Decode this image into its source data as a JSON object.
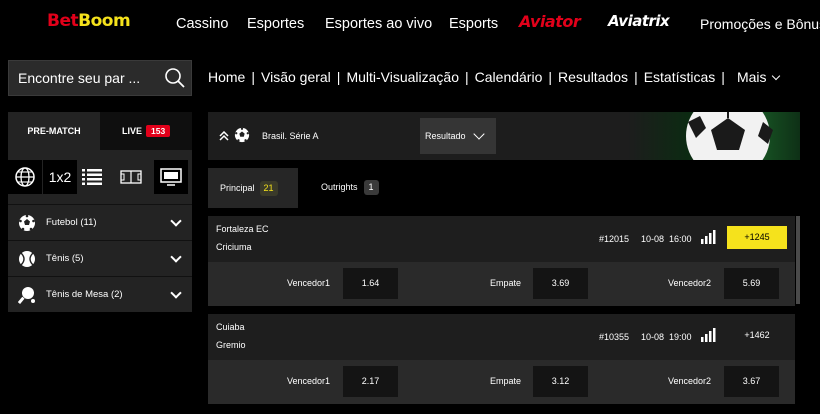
{
  "brand": {
    "part1": "Bet",
    "part2": "Boom"
  },
  "topnav": {
    "items": [
      "Cassino",
      "Esportes",
      "Esportes ao vivo",
      "Esports"
    ],
    "aviator": "Aviator",
    "aviatrix": "Aviatrix",
    "promo": "Promoções e Bônus"
  },
  "search": {
    "placeholder": "Encontre seu par ..."
  },
  "subnav": {
    "items": [
      "Home",
      "Visão geral",
      "Multi-Visualização",
      "Calendário",
      "Resultados",
      "Estatísticas"
    ],
    "more": "Mais"
  },
  "leftpanel": {
    "tab_prematch": "PRE-MATCH",
    "tab_live": "LIVE",
    "live_count": "153",
    "icon_1x2": "1x2",
    "sports": [
      {
        "label": "Futebol (11)",
        "icon": "soccer-ball-icon"
      },
      {
        "label": "Tênis (5)",
        "icon": "tennis-ball-icon"
      },
      {
        "label": "Tênis de Mesa (2)",
        "icon": "ping-pong-icon"
      }
    ]
  },
  "event_header": {
    "league": "Brasil. Série A",
    "dropdown": "Resultado"
  },
  "tabs": {
    "principal": "Principal",
    "principal_count": "21",
    "outrights": "Outrights",
    "outrights_count": "1"
  },
  "matches": [
    {
      "team1": "Fortaleza EC",
      "team2": "Criciuma",
      "id": "#12015",
      "date": "10-08",
      "time": "16:00",
      "more": "+1245",
      "highlight": true,
      "odds": [
        {
          "label": "Vencedor1",
          "value": "1.64"
        },
        {
          "label": "Empate",
          "value": "3.69"
        },
        {
          "label": "Vencedor2",
          "value": "5.69"
        }
      ]
    },
    {
      "team1": "Cuiaba",
      "team2": "Gremio",
      "id": "#10355",
      "date": "10-08",
      "time": "19:00",
      "more": "+1462",
      "highlight": false,
      "odds": [
        {
          "label": "Vencedor1",
          "value": "2.17"
        },
        {
          "label": "Empate",
          "value": "3.12"
        },
        {
          "label": "Vencedor2",
          "value": "3.67"
        }
      ]
    }
  ],
  "colors": {
    "brand_red": "#e2001a",
    "accent_yellow": "#f5e21c",
    "panel": "#232323"
  }
}
